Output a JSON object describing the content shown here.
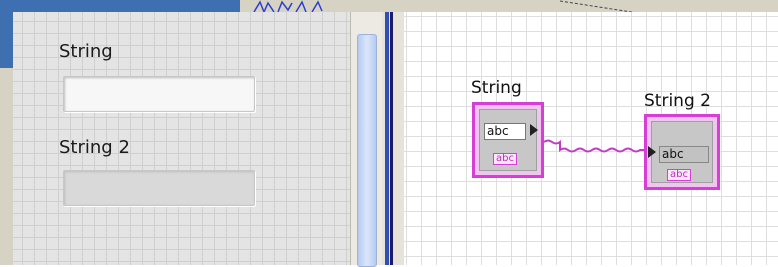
{
  "front_panel": {
    "string_control": {
      "label": "String",
      "value": ""
    },
    "string_indicator": {
      "label": "String 2",
      "value": ""
    }
  },
  "block_diagram": {
    "string_terminal": {
      "label": "String",
      "value": "abc",
      "type_tag": "abc"
    },
    "string2_terminal": {
      "label": "String 2",
      "value": "abc",
      "type_tag": "abc"
    },
    "wire_color": "#d63fd6"
  },
  "colors": {
    "frame": "#d6d3c4",
    "accent_blue": "#3e6fb1",
    "terminal_pink": "#d63fd6",
    "front_panel_bg": "#e4e4e4"
  }
}
